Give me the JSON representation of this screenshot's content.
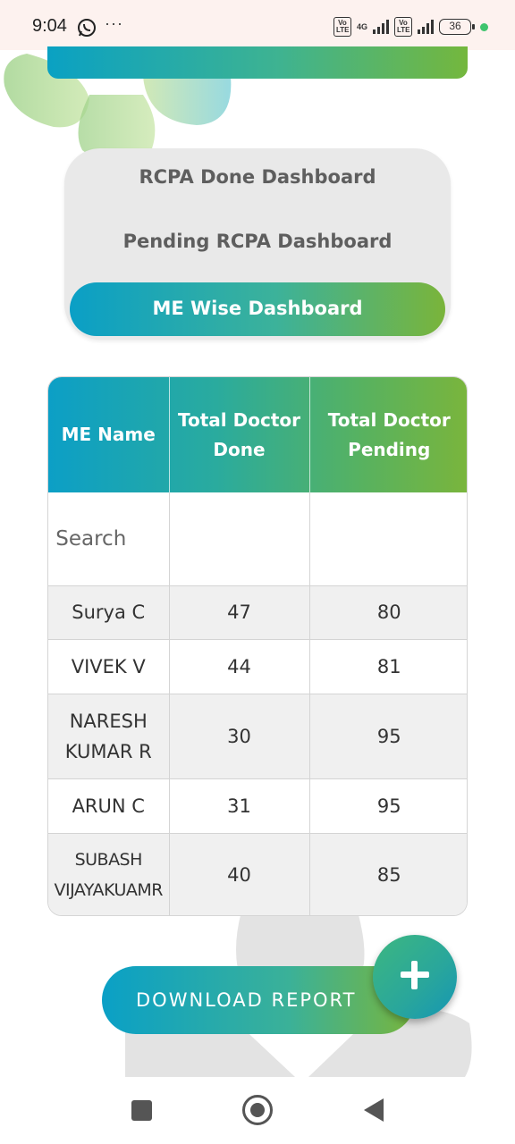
{
  "status_bar": {
    "time": "9:04",
    "icons": [
      "whatsapp-icon",
      "more-dots-icon",
      "volte-icon",
      "signal-4g-icon",
      "volte-icon",
      "signal-icon",
      "battery-icon"
    ],
    "dots": "···",
    "volte1": "Vo LTE",
    "network": "4G",
    "volte2": "Vo LTE",
    "battery": "36"
  },
  "menu": {
    "items": [
      {
        "label": "RCPA Done Dashboard",
        "active": false
      },
      {
        "label": "Pending RCPA Dashboard",
        "active": false
      },
      {
        "label": "ME Wise Dashboard",
        "active": true
      }
    ]
  },
  "table": {
    "headers": [
      "ME Name",
      "Total Doctor Done",
      "Total Doctor Pending"
    ],
    "search_placeholder": "Search",
    "rows": [
      {
        "name": "Surya C",
        "done": "47",
        "pending": "80"
      },
      {
        "name": "VIVEK V",
        "done": "44",
        "pending": "81"
      },
      {
        "name": "NARESH KUMAR R",
        "done": "30",
        "pending": "95"
      },
      {
        "name": "ARUN C",
        "done": "31",
        "pending": "95"
      },
      {
        "name": "SUBASH VIJAYAKUAMR",
        "done": "40",
        "pending": "85"
      }
    ]
  },
  "download": {
    "label": "DOWNLOAD REPORT"
  },
  "fab": {
    "icon": "plus-icon"
  },
  "colors": {
    "gradient_start": "#0aa0c6",
    "gradient_end": "#78b53d",
    "menu_bg": "#e9e9e9"
  }
}
